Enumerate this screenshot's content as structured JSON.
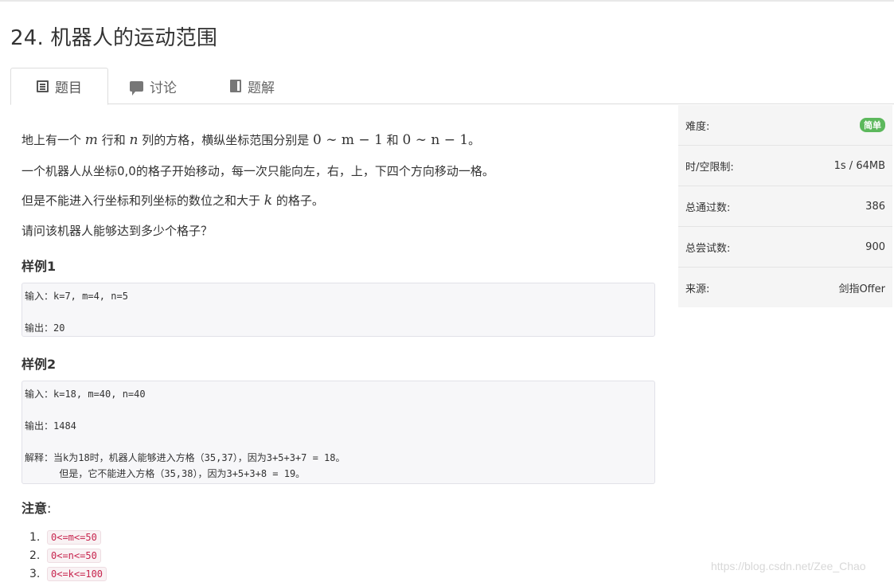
{
  "title": "24. 机器人的运动范围",
  "tabs": [
    {
      "label": "题目",
      "icon": "list-icon"
    },
    {
      "label": "讨论",
      "icon": "chat-icon"
    },
    {
      "label": "题解",
      "icon": "book-icon"
    }
  ],
  "problem": {
    "line1_pre": "地上有一个",
    "line1_m": "m",
    "line1_mid1": "行和",
    "line1_n": "n",
    "line1_mid2": "列的方格，横纵坐标范围分别是",
    "line1_range1": "0 ∼ m − 1",
    "line1_and": "和",
    "line1_range2": "0 ∼ n − 1",
    "line1_end": "。",
    "line2": "一个机器人从坐标0,0的格子开始移动，每一次只能向左，右，上，下四个方向移动一格。",
    "line3_pre": "但是不能进入行坐标和列坐标的数位之和大于",
    "line3_k": "k",
    "line3_post": "的格子。",
    "line4": "请问该机器人能够达到多少个格子？"
  },
  "examples": [
    {
      "heading": "样例1",
      "code": "输入：k=7, m=4, n=5\n\n输出：20"
    },
    {
      "heading": "样例2",
      "code": "输入：k=18, m=40, n=40\n\n输出：1484\n\n解释：当k为18时，机器人能够进入方格（35,37），因为3+5+3+7 = 18。\n      但是，它不能进入方格（35,38），因为3+5+3+8 = 19。"
    }
  ],
  "notes": {
    "heading": "注意",
    "colon": ":",
    "items": [
      {
        "num": "1.",
        "code": "0<=m<=50"
      },
      {
        "num": "2.",
        "code": "0<=n<=50"
      },
      {
        "num": "3.",
        "code": "0<=k<=100"
      }
    ]
  },
  "sidebar": [
    {
      "label": "难度:",
      "value": "简单",
      "badge": true
    },
    {
      "label": "时/空限制:",
      "value": "1s / 64MB"
    },
    {
      "label": "总通过数:",
      "value": "386"
    },
    {
      "label": "总尝试数:",
      "value": "900"
    },
    {
      "label": "来源:",
      "value": "剑指Offer"
    }
  ],
  "colors": {
    "badge": "#5cb85c",
    "inline_code": "#c7254e"
  },
  "watermark": "https://blog.csdn.net/Zee_Chao"
}
